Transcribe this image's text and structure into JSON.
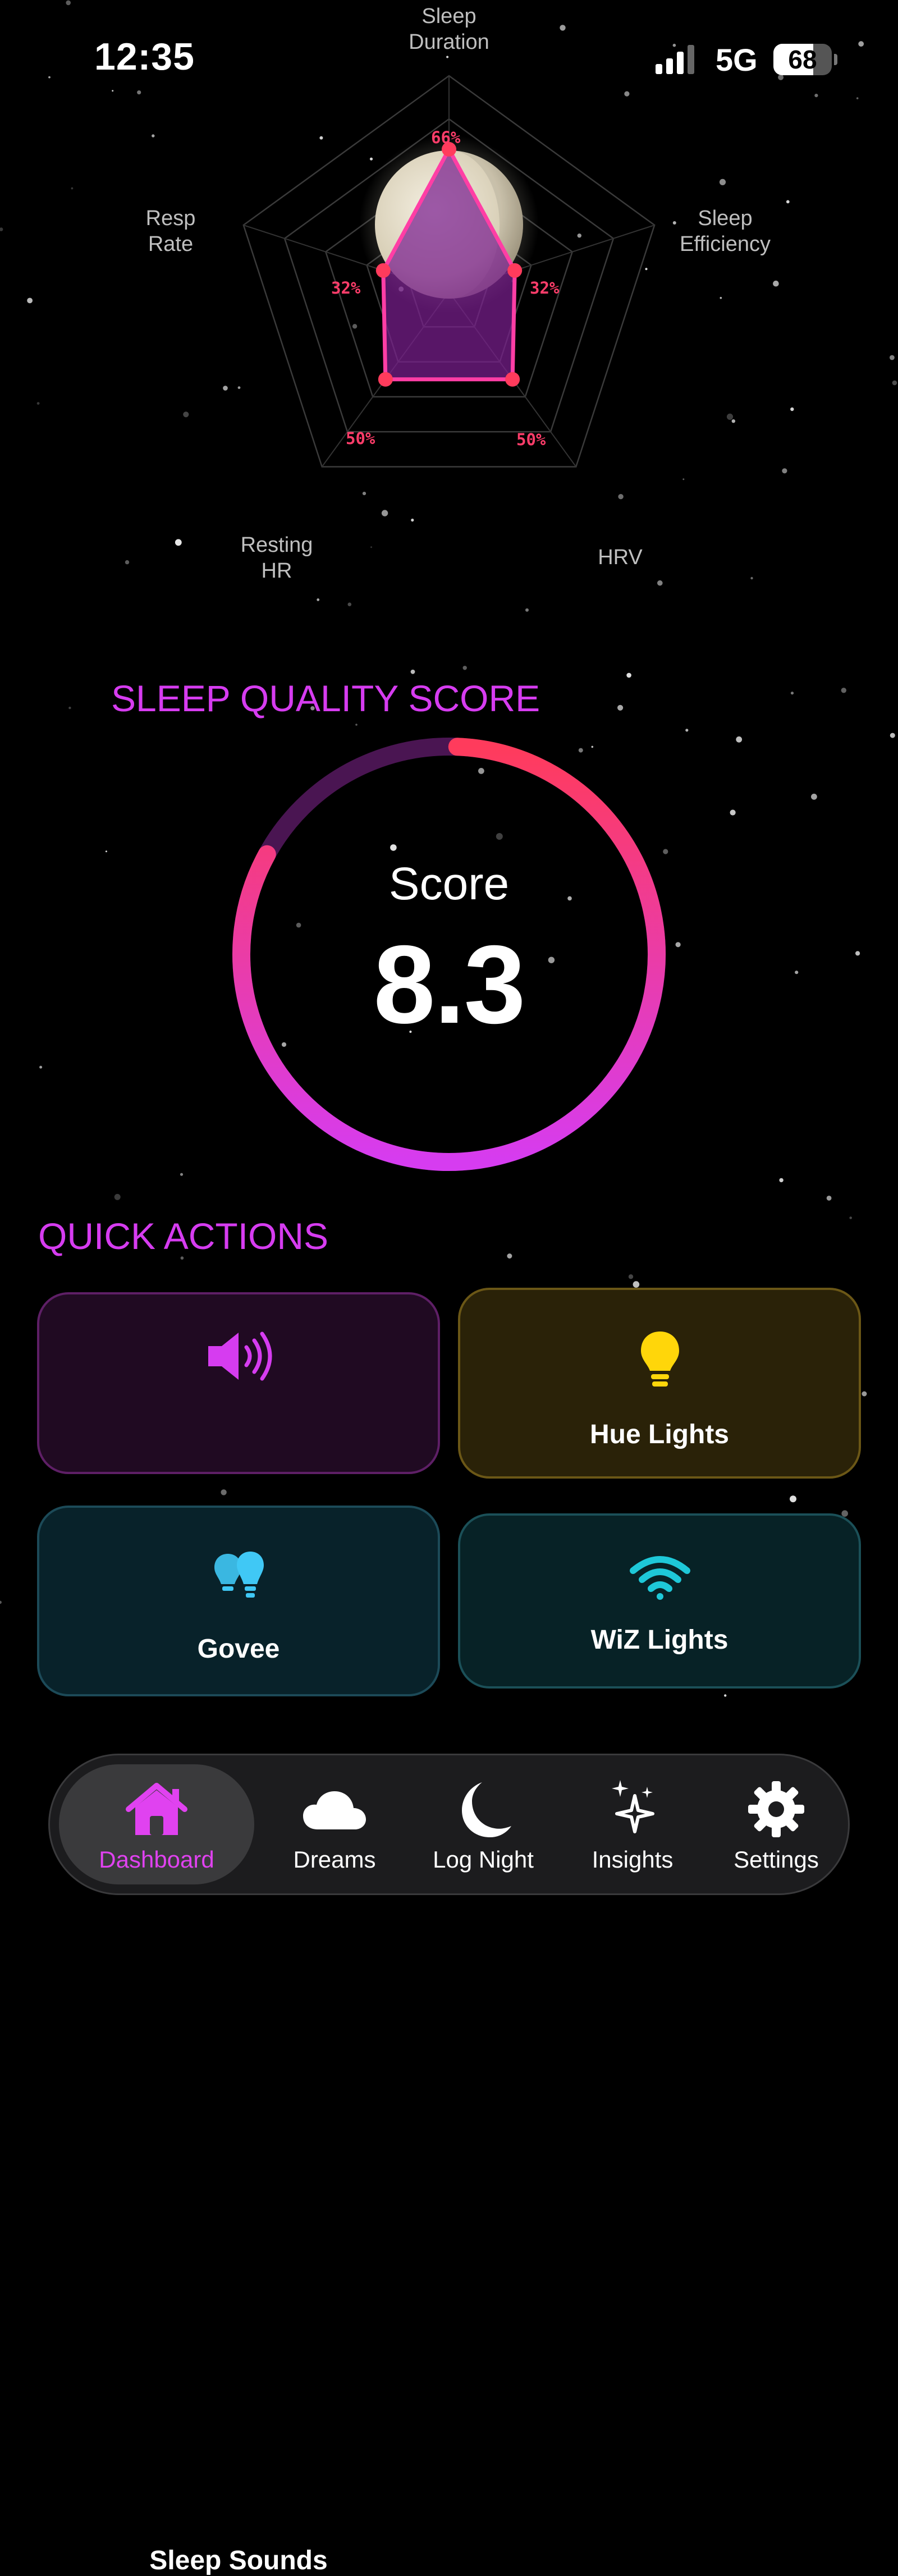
{
  "status_bar": {
    "time": "12:35",
    "network": "5G",
    "battery": "68",
    "battery_level": 0.68
  },
  "radar_chart": {
    "axes": [
      {
        "label": "Sleep\nDuration",
        "value_label": "66%",
        "value": 66
      },
      {
        "label": "Sleep\nEfficiency",
        "value_label": "32%",
        "value": 32
      },
      {
        "label": "HRV",
        "value_label": "50%",
        "value": 50
      },
      {
        "label": "Resting\nHR",
        "value_label": "50%",
        "value": 50
      },
      {
        "label": "Resp\nRate",
        "value_label": "32%",
        "value": 32
      }
    ],
    "fill_color": "#7a1f8f",
    "stroke_color": "#ff3ea5",
    "point_color": "#ff3b5c",
    "moon_icon": "moon-phase-icon"
  },
  "sleep_quality": {
    "title": "SLEEP QUALITY SCORE",
    "score_label": "Score",
    "score_value": "8.3",
    "score_fraction": 0.83,
    "gradient_start": "#ff3b5c",
    "gradient_end": "#d63cf0",
    "track_color": "#4a1552"
  },
  "quick_actions": {
    "title": "QUICK ACTIONS",
    "items": [
      {
        "label": "Sleep Sounds",
        "icon": "speaker-wave-icon",
        "accent": "#d63cf0"
      },
      {
        "label": "Hue Lights",
        "icon": "lightbulb-icon",
        "accent": "#ffd60a"
      },
      {
        "label": "Govee",
        "icon": "bulbs-icon",
        "accent": "#40c8f5"
      },
      {
        "label": "WiZ Lights",
        "icon": "wifi-icon",
        "accent": "#1ec8d8"
      }
    ]
  },
  "tab_bar": {
    "tabs": [
      {
        "label": "Dashboard",
        "icon": "house-icon",
        "active": true
      },
      {
        "label": "Dreams",
        "icon": "cloud-icon",
        "active": false
      },
      {
        "label": "Log Night",
        "icon": "moon-icon",
        "active": false
      },
      {
        "label": "Insights",
        "icon": "sparkles-icon",
        "active": false
      },
      {
        "label": "Settings",
        "icon": "gear-icon",
        "active": false
      }
    ],
    "active_color": "#e042f0"
  }
}
